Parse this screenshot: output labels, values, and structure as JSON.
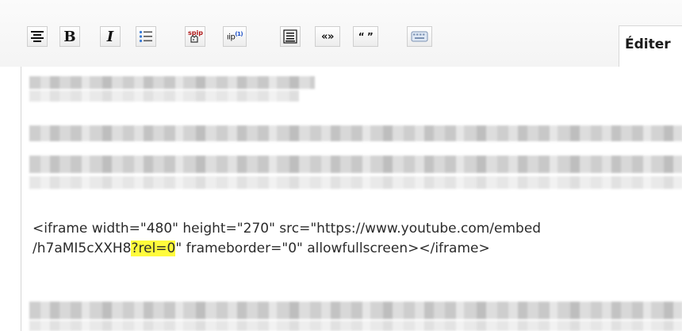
{
  "toolbar": {
    "buttons": [
      {
        "name": "align-center-icon"
      },
      {
        "name": "bold",
        "label": "B"
      },
      {
        "name": "italic",
        "label": "I"
      },
      {
        "name": "bullet-list-icon"
      },
      {
        "name": "spip-logo-icon",
        "label": "spip"
      },
      {
        "name": "footnote",
        "label": "ıip",
        "sup": "(1)"
      },
      {
        "name": "framed-text-icon"
      },
      {
        "name": "guillemets",
        "label": "«»"
      },
      {
        "name": "quotes",
        "label": "“ ”"
      },
      {
        "name": "keyboard-icon"
      }
    ],
    "tab_label": "Éditer"
  },
  "editor": {
    "line1": "<iframe width=\"480\" height=\"270\" src=\"https://www.youtube.com/embed",
    "line2_before": "/h7aMI5cXXH8",
    "line2_highlight": "?rel=0",
    "line2_after": "\" frameborder=\"0\" allowfullscreen></iframe>",
    "highlight_color": "#fffb3c"
  }
}
